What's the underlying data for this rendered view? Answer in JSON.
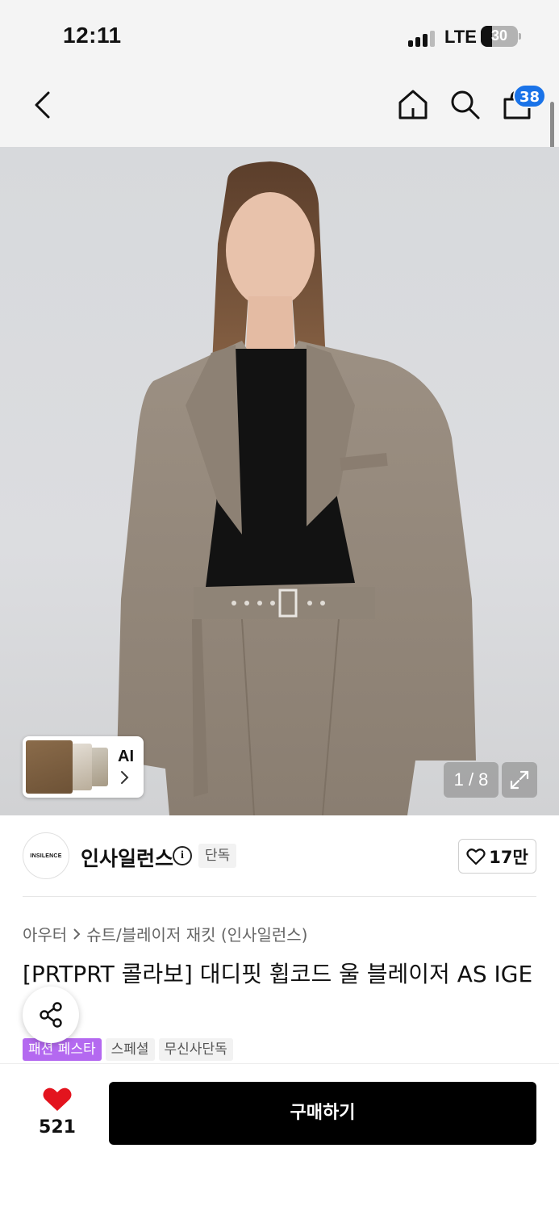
{
  "status_bar": {
    "time": "12:11",
    "network": "LTE",
    "battery": "30",
    "battery_level": 0.3
  },
  "header": {
    "cart_count": "38"
  },
  "gallery": {
    "ai_label": "AI",
    "page_indicator": "1 / 8"
  },
  "brand": {
    "logo_text": "INSILENCE",
    "name": "인사일런스",
    "info_icon": "i",
    "exclusive_badge": "단독",
    "likes": "17만"
  },
  "product": {
    "breadcrumb": [
      "아우터",
      "슈트/블레이저 재킷 (인사일런스)"
    ],
    "title": "[PRTPRT 콜라보] 대디핏 휩코드 울 블레이저 AS IGE",
    "tags": [
      "패션 페스타",
      "스페셜",
      "무신사단독"
    ]
  },
  "bottom_bar": {
    "wish_count": "521",
    "buy_label": "구매하기"
  },
  "colors": {
    "accent_blue": "#1a73e8",
    "festa_purple": "#b469f0",
    "heart_red": "#e3141e",
    "buy_button": "#000000"
  },
  "icons": [
    "back-icon",
    "home-icon",
    "search-icon",
    "cart-icon",
    "chevron-right-icon",
    "expand-icon",
    "info-icon",
    "heart-outline-icon",
    "share-icon",
    "heart-filled-icon"
  ]
}
